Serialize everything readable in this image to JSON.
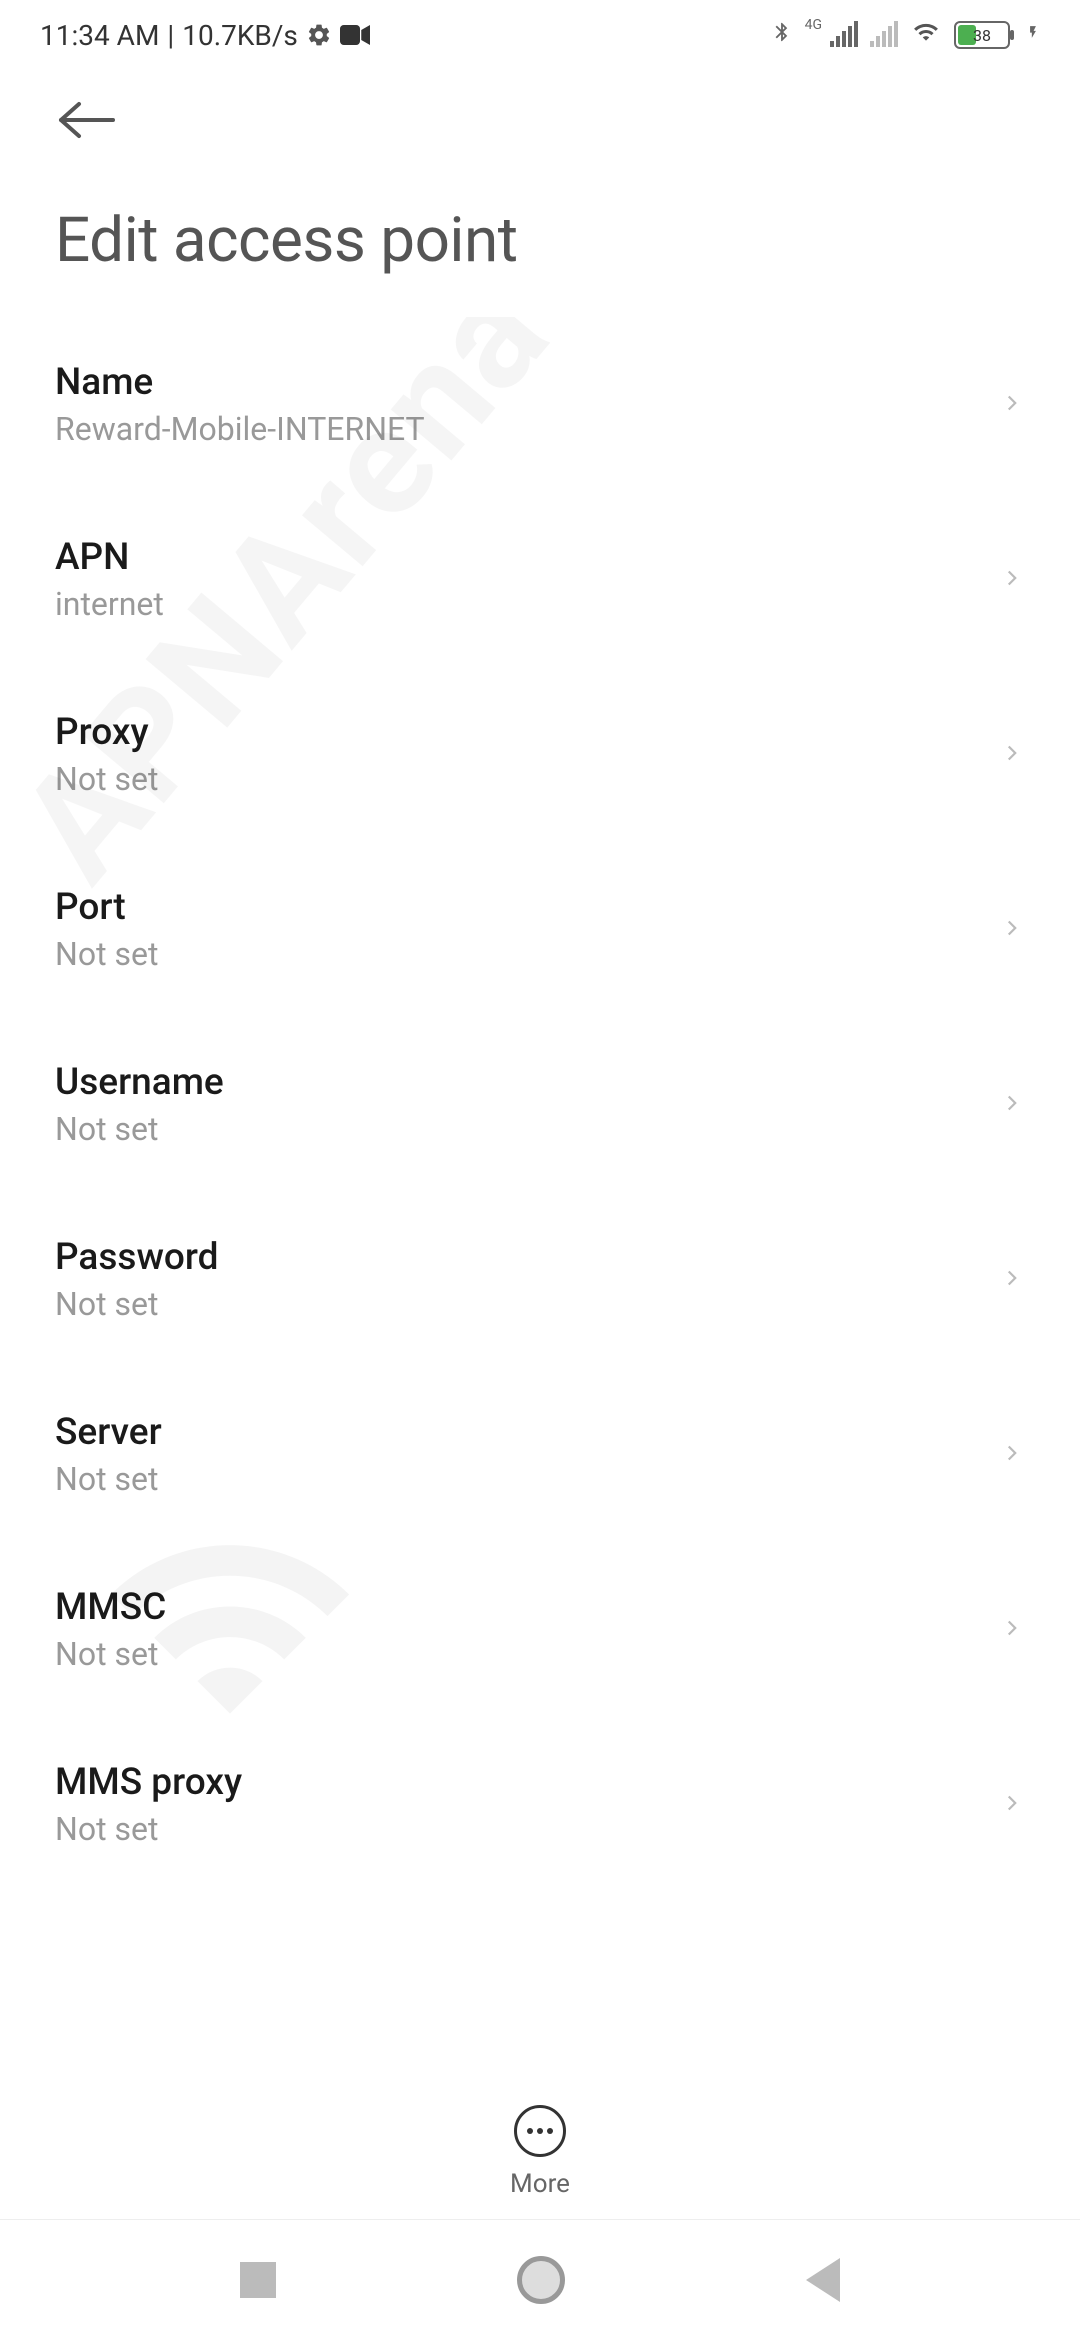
{
  "status_bar": {
    "time": "11:34 AM",
    "data_rate": "10.7KB/s",
    "network_label": "4G",
    "battery_pct": "38"
  },
  "header": {
    "title": "Edit access point"
  },
  "settings": [
    {
      "label": "Name",
      "value": "Reward-Mobile-INTERNET"
    },
    {
      "label": "APN",
      "value": "internet"
    },
    {
      "label": "Proxy",
      "value": "Not set"
    },
    {
      "label": "Port",
      "value": "Not set"
    },
    {
      "label": "Username",
      "value": "Not set"
    },
    {
      "label": "Password",
      "value": "Not set"
    },
    {
      "label": "Server",
      "value": "Not set"
    },
    {
      "label": "MMSC",
      "value": "Not set"
    },
    {
      "label": "MMS proxy",
      "value": "Not set"
    }
  ],
  "bottom_bar": {
    "more_label": "More"
  },
  "watermark": {
    "text": "APNArena"
  }
}
